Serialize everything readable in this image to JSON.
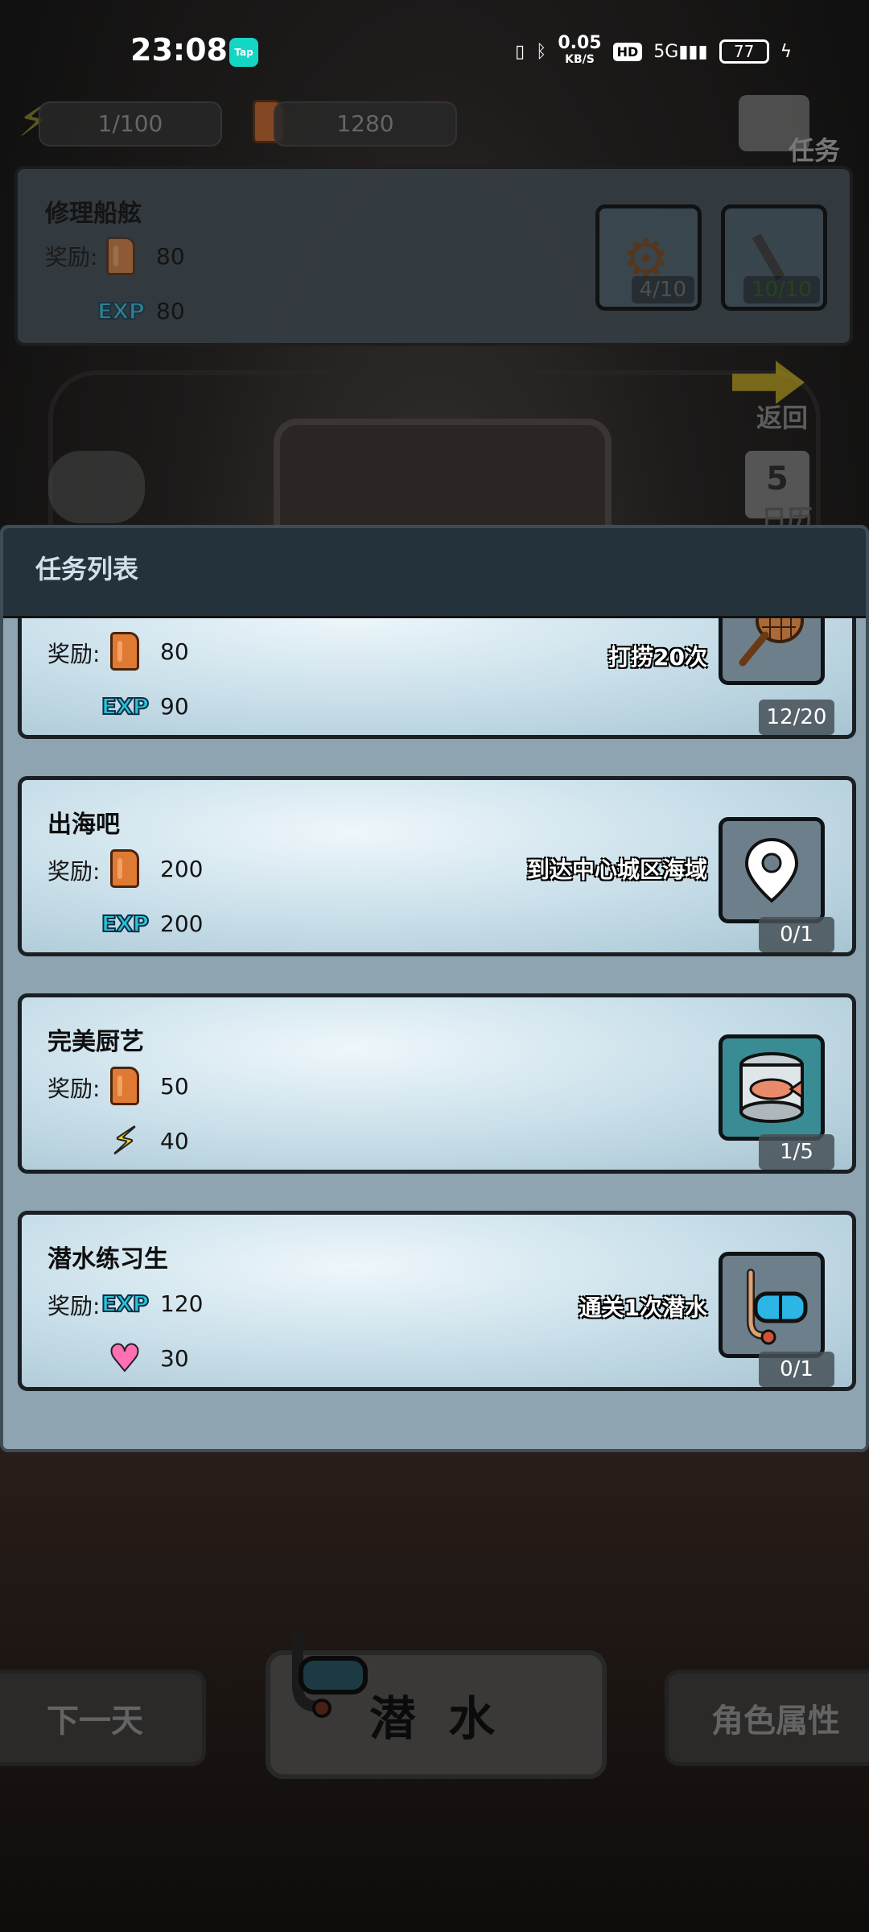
{
  "status_bar": {
    "time": "23:08",
    "app_badge": "Tap",
    "net_speed": "0.05",
    "net_unit": "KB/S",
    "hd": "HD",
    "signal": "5G",
    "battery": "77"
  },
  "resources": {
    "energy": "1/100",
    "fuel": "1280"
  },
  "top_nav": {
    "tasks_label": "任务",
    "back_label": "返回",
    "calendar_day": "5",
    "calendar_label": "日历"
  },
  "top_mission": {
    "title": "修理船舷",
    "reward_label": "奖励:",
    "fuel_reward": "80",
    "exp_reward": "80",
    "exp_label": "EXP",
    "requirements": [
      {
        "icon": "gear-icon",
        "progress": "4/10"
      },
      {
        "icon": "screw-icon",
        "progress": "10/10"
      }
    ]
  },
  "panel": {
    "title": "任务列表",
    "tasks": [
      {
        "title": "",
        "reward_label": "奖励:",
        "rewards": [
          {
            "icon": "fuel-can-icon",
            "value": "80"
          },
          {
            "icon": "exp-icon",
            "label": "EXP",
            "value": "90"
          }
        ],
        "description": "打捞20次",
        "task_icon": "fishing-net-icon",
        "progress": "12/20"
      },
      {
        "title": "出海吧",
        "reward_label": "奖励:",
        "rewards": [
          {
            "icon": "fuel-can-icon",
            "value": "200"
          },
          {
            "icon": "exp-icon",
            "label": "EXP",
            "value": "200"
          }
        ],
        "description": "到达中心城区海域",
        "task_icon": "location-pin-icon",
        "progress": "0/1"
      },
      {
        "title": "完美厨艺",
        "reward_label": "奖励:",
        "rewards": [
          {
            "icon": "fuel-can-icon",
            "value": "50"
          },
          {
            "icon": "energy-bolt-icon",
            "value": "40"
          }
        ],
        "description": "",
        "task_icon": "canned-fish-icon",
        "progress": "1/5"
      },
      {
        "title": "潜水练习生",
        "reward_label": "奖励:",
        "rewards": [
          {
            "icon": "exp-icon",
            "label": "EXP",
            "value": "120"
          },
          {
            "icon": "heart-icon",
            "value": "30"
          }
        ],
        "description": "通关1次潜水",
        "task_icon": "diving-mask-icon",
        "progress": "0/1"
      }
    ]
  },
  "bottom": {
    "next_day": "下一天",
    "dive": "潜 水",
    "character": "角色属性"
  },
  "colors": {
    "card_bg": "#c6dde8",
    "header_bg": "#24323b",
    "exp": "#2cc4d6",
    "fuel": "#df7a34"
  }
}
